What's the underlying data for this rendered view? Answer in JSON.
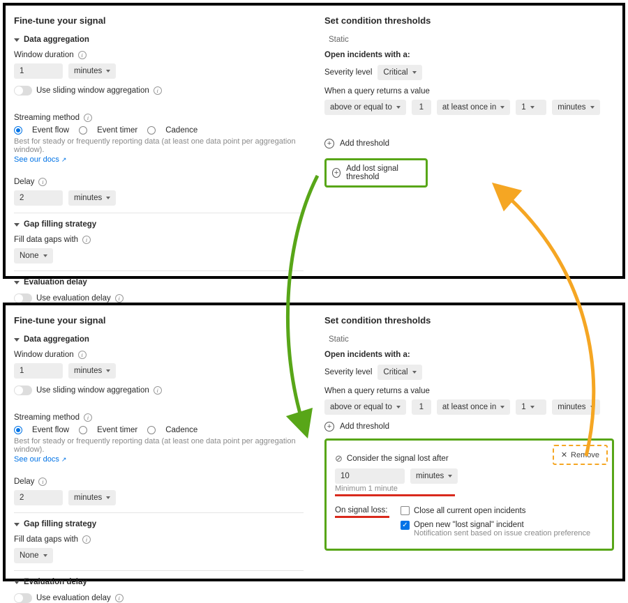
{
  "left": {
    "title": "Fine-tune your signal",
    "agg_section": "Data aggregation",
    "window_label": "Window duration",
    "window_value": "1",
    "window_unit": "minutes",
    "sliding_label": "Use sliding window aggregation",
    "stream_label": "Streaming method",
    "stream_opts": {
      "flow": "Event flow",
      "timer": "Event timer",
      "cadence": "Cadence"
    },
    "stream_hint": "Best for steady or frequently reporting data (at least one data point per aggregation window).",
    "stream_link": "See our docs",
    "delay_label": "Delay",
    "delay_value": "2",
    "delay_unit": "minutes",
    "gap_section": "Gap filling strategy",
    "gap_label": "Fill data gaps with",
    "gap_value": "None",
    "eval_section": "Evaluation delay",
    "eval_label": "Use evaluation delay"
  },
  "right": {
    "title": "Set condition thresholds",
    "static_label": "Static",
    "open_label": "Open incidents with a:",
    "severity_label": "Severity level",
    "severity_value": "Critical",
    "query_label": "When a query returns a value",
    "op": "above or equal to",
    "op_val": "1",
    "freq": "at least once in",
    "freq_val": "1",
    "freq_unit": "minutes",
    "add_threshold": "Add threshold",
    "add_lost": "Add lost signal threshold"
  },
  "lost": {
    "title": "Consider the signal lost after",
    "value": "10",
    "unit": "minutes",
    "min_hint": "Minimum 1 minute",
    "on_loss_label": "On signal loss:",
    "close_label": "Close all current open incidents",
    "open_new_label": "Open new \"lost signal\" incident",
    "open_new_hint": "Notification sent based on issue creation preference",
    "remove": "Remove"
  }
}
